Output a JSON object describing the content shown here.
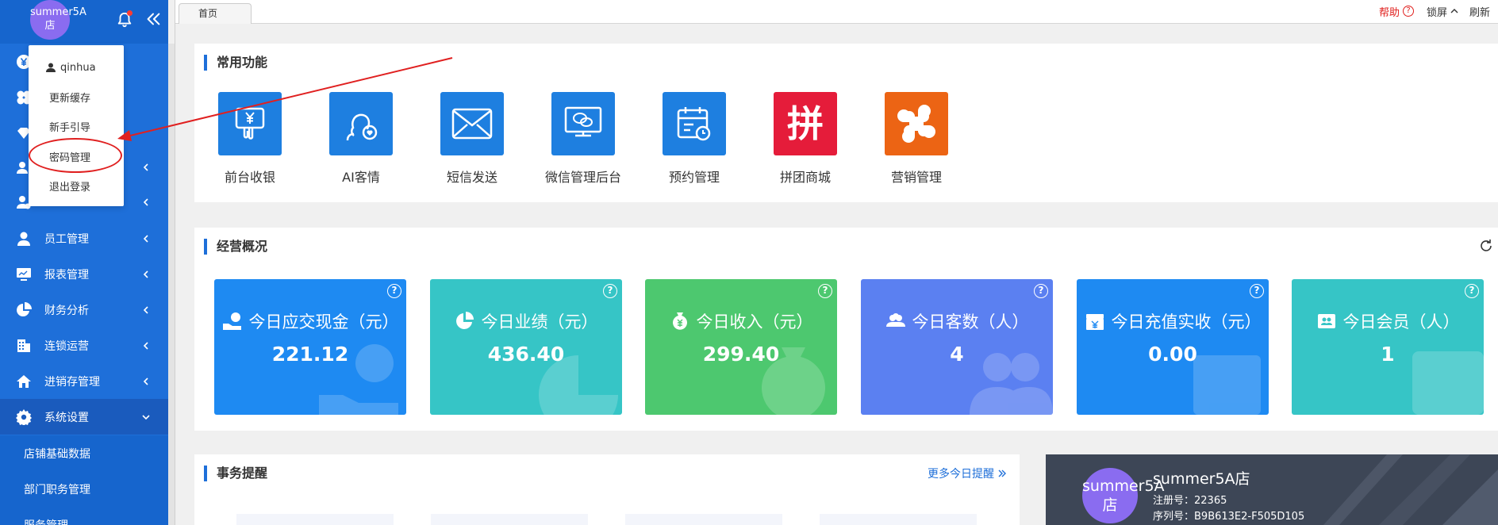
{
  "user": {
    "avatar_text": "summer5A店",
    "name": "qinhua"
  },
  "dropdown": [
    {
      "label": "更新缓存"
    },
    {
      "label": "新手引导"
    },
    {
      "label": "密码管理"
    },
    {
      "label": "退出登录"
    }
  ],
  "sidebar": {
    "items": [
      {
        "label": "员工管理",
        "icon": "user-icon"
      },
      {
        "label": "报表管理",
        "icon": "monitor-icon"
      },
      {
        "label": "财务分析",
        "icon": "pie-chart-icon"
      },
      {
        "label": "连锁运营",
        "icon": "building-icon"
      },
      {
        "label": "进销存管理",
        "icon": "home-icon"
      },
      {
        "label": "系统设置",
        "icon": "gear-icon"
      }
    ],
    "sub_items": [
      {
        "label": "店铺基础数据"
      },
      {
        "label": "部门职务管理"
      },
      {
        "label": "服务管理"
      }
    ]
  },
  "topbar": {
    "tab": "首页",
    "help": "帮助",
    "help_q": "?",
    "lock": "锁屏",
    "refresh": "刷新"
  },
  "functions": {
    "title": "常用功能",
    "items": [
      {
        "label": "前台收银",
        "color": "#1e7fe0",
        "icon": "cashier-icon"
      },
      {
        "label": "AI客情",
        "color": "#1e7fe0",
        "icon": "ai-customer-icon"
      },
      {
        "label": "短信发送",
        "color": "#1e7fe0",
        "icon": "mail-icon"
      },
      {
        "label": "微信管理后台",
        "color": "#1e7fe0",
        "icon": "wechat-icon"
      },
      {
        "label": "预约管理",
        "color": "#1e7fe0",
        "icon": "calendar-icon"
      },
      {
        "label": "拼团商城",
        "color": "#e51c3a",
        "icon": "group-buy-icon",
        "glyph": "拼"
      },
      {
        "label": "营销管理",
        "color": "#ec6414",
        "icon": "clover-icon"
      }
    ]
  },
  "overview": {
    "title": "经营概况",
    "cards": [
      {
        "label": "今日应交现金（元）",
        "value": "221.12",
        "color": "#1e8af2"
      },
      {
        "label": "今日业绩（元）",
        "value": "436.40",
        "color": "#36c5c6"
      },
      {
        "label": "今日收入（元）",
        "value": "299.40",
        "color": "#4dc86f"
      },
      {
        "label": "今日客数（人）",
        "value": "4",
        "color": "#5b80f1"
      },
      {
        "label": "今日充值实收（元）",
        "value": "0.00",
        "color": "#1e8af2"
      },
      {
        "label": "今日会员（人）",
        "value": "1",
        "color": "#36c5c6"
      }
    ],
    "help_q": "?"
  },
  "tasks": {
    "title": "事务提醒",
    "more": "更多今日提醒"
  },
  "shop": {
    "avatar_text": "summer5A店",
    "name": "summer5A店",
    "reg": "注册号：22365",
    "serial": "序列号：B9B613E2-F505D105"
  }
}
